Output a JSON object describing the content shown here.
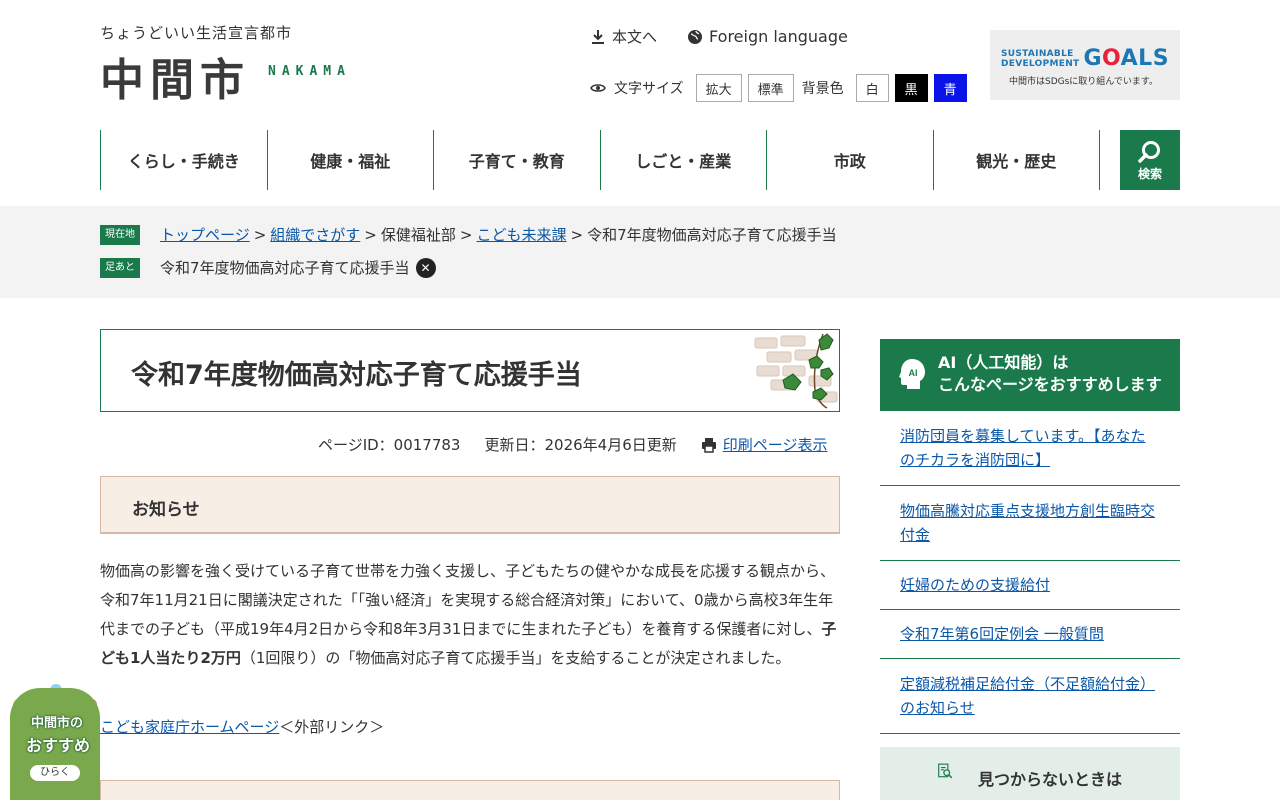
{
  "header": {
    "tagline": "ちょうどいい生活宣言都市",
    "logo_text": "中間市",
    "logo_roman": "NAKAMA",
    "skip_link": "本文へ",
    "foreign_language": "Foreign language",
    "font_size_label": "文字サイズ",
    "font_large": "拡大",
    "font_standard": "標準",
    "bg_color_label": "背景色",
    "bg_white": "白",
    "bg_black": "黒",
    "bg_blue": "青",
    "sdgs": {
      "line1": "SUSTAINABLE",
      "line2": "DEVELOPMENT",
      "goals_g": "G",
      "goals_o": "O",
      "goals_rest": "ALS",
      "sub": "中間市はSDGsに取り組んでいます。"
    }
  },
  "nav": {
    "items": [
      "くらし・手続き",
      "健康・福祉",
      "子育て・教育",
      "しごと・産業",
      "市政",
      "観光・歴史"
    ],
    "search_label": "検索"
  },
  "breadcrumb": {
    "current_tag": "現在地",
    "items": [
      "トップページ",
      "組織でさがす",
      "保健福祉部",
      "こども未来課",
      "令和7年度物価高対応子育て応援手当"
    ],
    "sep": ">",
    "history_tag": "足あと",
    "history_item": "令和7年度物価高対応子育て応援手当"
  },
  "page": {
    "title": "令和7年度物価高対応子育て応援手当",
    "page_id": "ページID：0017783",
    "updated": "更新日：2026年4月6日更新",
    "print_link": "印刷ページ表示",
    "notice_heading": "お知らせ",
    "body_part1": "物価高の影響を強く受けている子育て世帯を力強く支援し、子どもたちの健やかな成長を応援する観点から、令和7年11月21日に閣議決定された「「強い経済」を実現する総合経済対策」において、0歳から高校3年生年代までの子ども（平成19年4月2日から令和8年3月31日までに生まれた子ども）を養育する保護者に対し、",
    "body_bold": "子ども1人当たり2万円",
    "body_part2": "（1回限り）の「物価高対応子育て応援手当」を支給することが決定されました。",
    "ext_link": "こども家庭庁ホームページ",
    "ext_note": "＜外部リンク＞"
  },
  "sidebar": {
    "ai_title_line1": "AI（人工知能）は",
    "ai_title_line2": "こんなページをおすすめします",
    "ai_icon_text": "AI",
    "recommendations": [
      "消防団員を募集しています。【あなたのチカラを消防団に】",
      "物価高騰対応重点支援地方創生臨時交付金",
      "妊婦のための支援給付",
      "令和7年第6回定例会 一般質問",
      "定額減税補足給付金（不足額給付金）のお知らせ"
    ],
    "not_found": "見つからないときは"
  },
  "recommend_badge": {
    "line1": "中間市の",
    "line2": "おすすめ",
    "open": "ひらく"
  }
}
